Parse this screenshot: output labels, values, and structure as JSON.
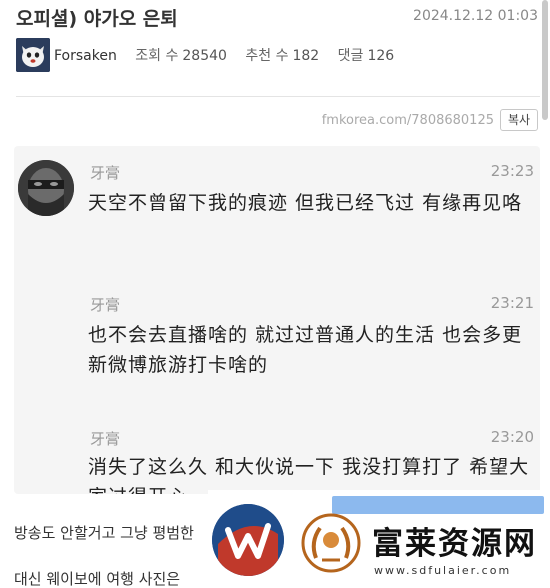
{
  "post": {
    "title": "오피셜) 야가오 은퇴",
    "date": "2024.12.12 01:03",
    "author": "Forsaken",
    "views_label": "조회 수",
    "views": "28540",
    "likes_label": "추천 수",
    "likes": "182",
    "comments_label": "댓글",
    "comments": "126",
    "url": "fmkorea.com/7808680125",
    "copy_label": "복사"
  },
  "screenshot": {
    "messages": [
      {
        "sender": "牙膏",
        "time": "23:23",
        "text": "天空不曾留下我的痕迹 但我已经飞过 有缘再见咯"
      },
      {
        "sender": "牙膏",
        "time": "23:21",
        "text": "也不会去直播啥的 就过过普通人的生活 也会多更新微博旅游打卡啥的"
      },
      {
        "sender": "牙膏",
        "time": "23:20",
        "text": "消失了这么久 和大伙说一下 我没打算打了 希望大家过得开心"
      }
    ]
  },
  "body": {
    "line1": "방송도 안할거고 그냥 평범한",
    "line2": "대신 웨이보에 여행 사진은"
  },
  "ad": {
    "name": "富莱资源网",
    "domain": "www.sdfulaier.com"
  },
  "icons": [
    "fox-avatar",
    "masked-face-avatar",
    "w-logo",
    "laurel-emblem"
  ]
}
